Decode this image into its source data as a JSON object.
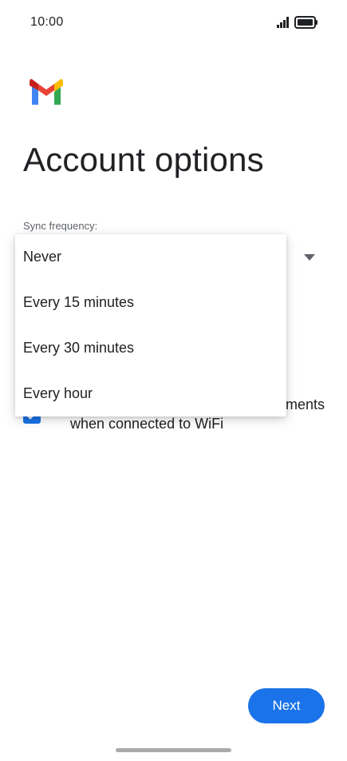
{
  "status_bar": {
    "time": "10:00"
  },
  "header": {
    "logo_icon": "gmail-logo-icon",
    "title": "Account options"
  },
  "sync": {
    "label": "Sync frequency:",
    "options": [
      "Never",
      "Every 15 minutes",
      "Every 30 minutes",
      "Every hour"
    ]
  },
  "checkbox": {
    "checked": true,
    "label_line1": "ments",
    "label_line2": "when connected to WiFi"
  },
  "footer": {
    "next_label": "Next"
  },
  "colors": {
    "accent": "#1a73e8",
    "text_primary": "#202124",
    "text_secondary": "#5f6368"
  }
}
